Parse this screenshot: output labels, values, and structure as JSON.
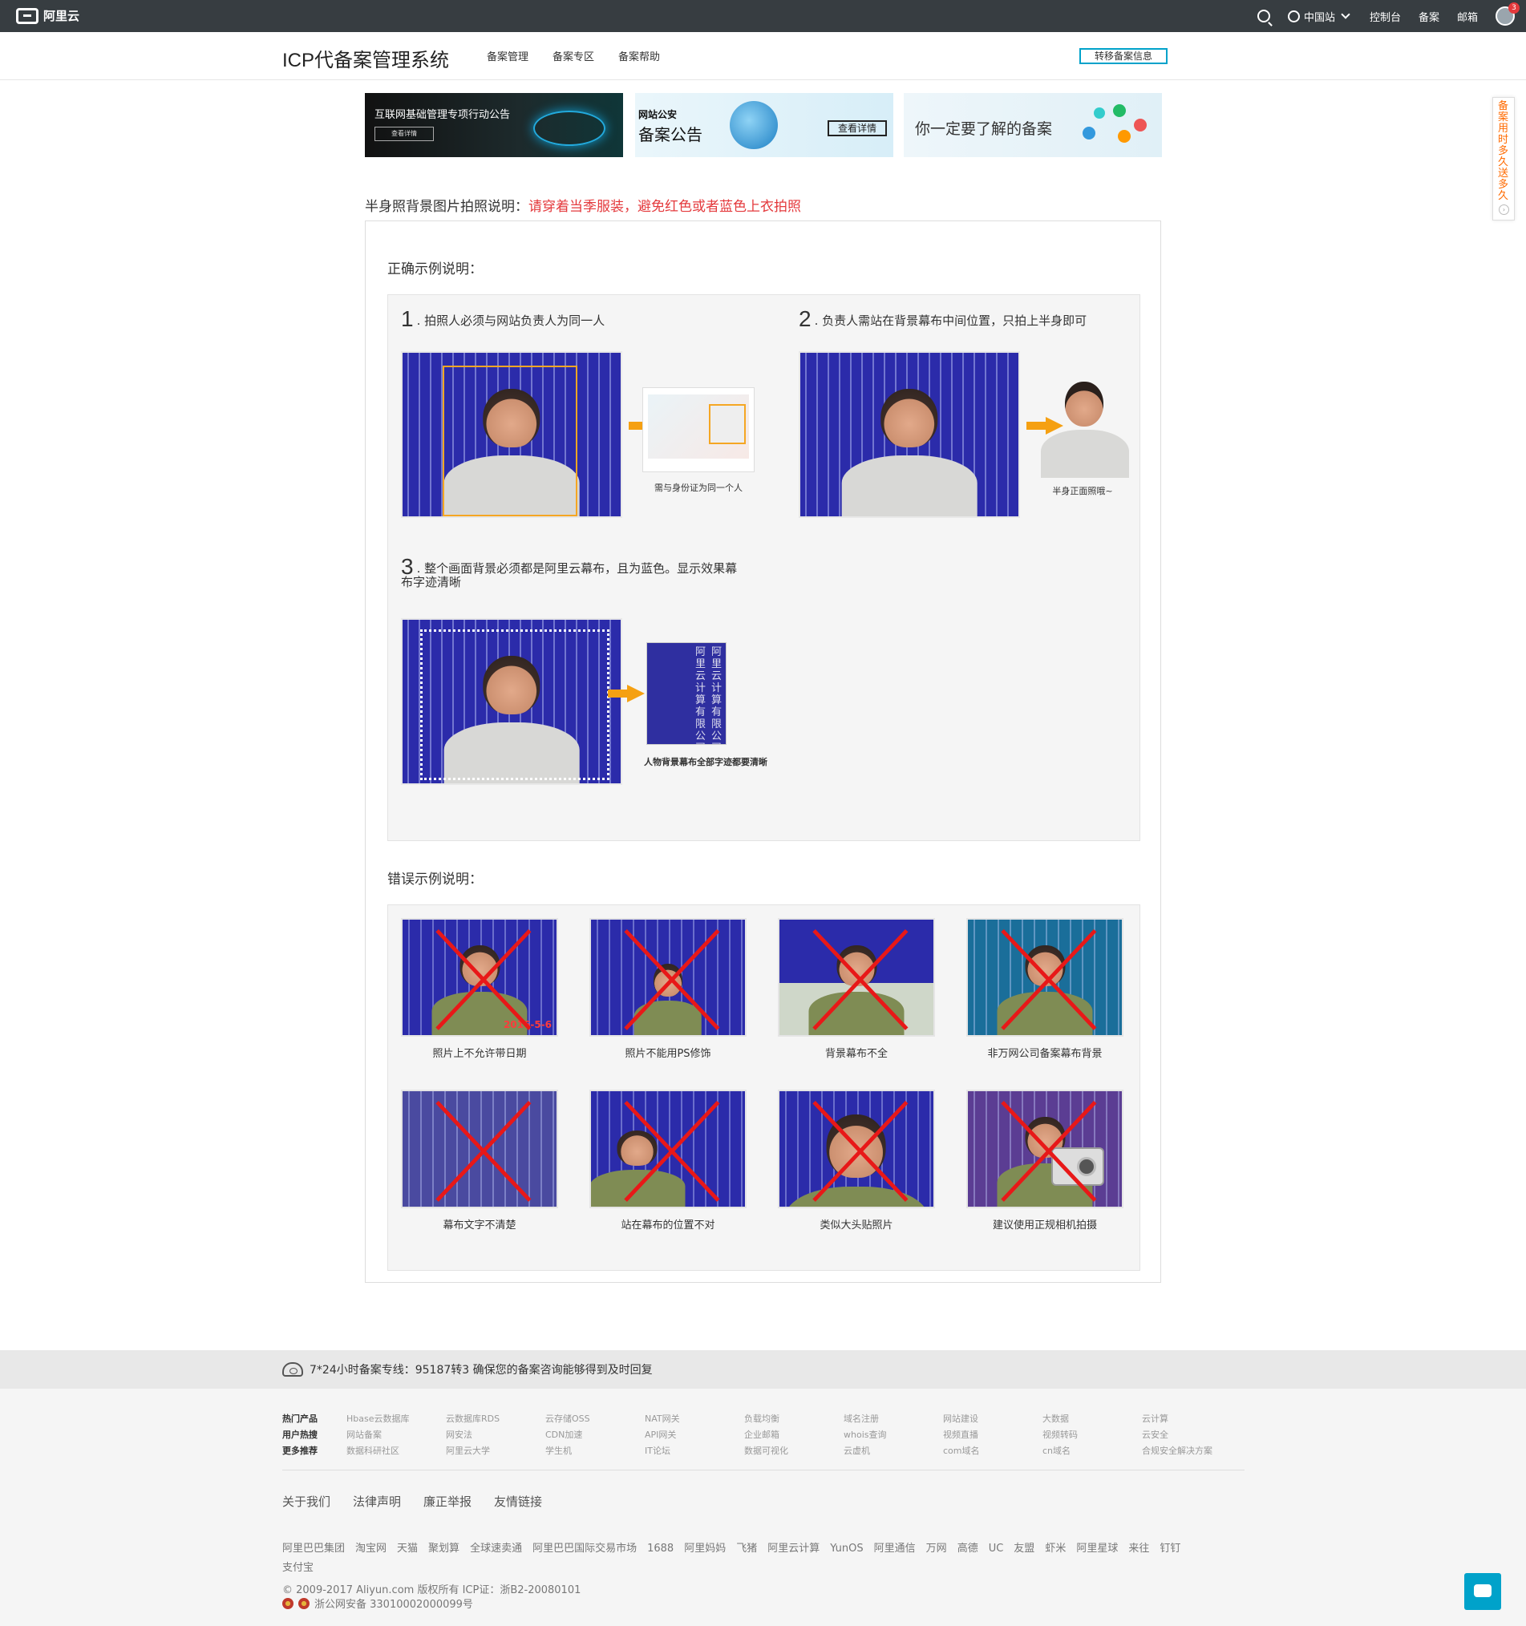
{
  "topbar": {
    "logo": "阿里云",
    "region": "中国站",
    "console": "控制台",
    "beian": "备案",
    "mail": "邮箱",
    "badge_count": "3"
  },
  "header": {
    "title": "ICP代备案管理系统",
    "nav": [
      "备案管理",
      "备案专区",
      "备案帮助"
    ],
    "transfer_button": "转移备案信息"
  },
  "banners": {
    "b1_title": "互联网基础管理专项行动公告",
    "b1_button": "查看详情",
    "b2_small": "网站公安",
    "b2_big": "备案公告",
    "b2_button": "查看详情",
    "b3_title": "你一定要了解的备案"
  },
  "side_tab": "备案用时多久送多久",
  "notice": {
    "label": "半身照背景图片拍照说明：",
    "warning": "请穿着当季服装，避免红色或者蓝色上衣拍照"
  },
  "correct": {
    "title": "正确示例说明：",
    "ex1": {
      "num": "1",
      "text": ". 拍照人必须与网站负责人为同一人",
      "caption": "需与身份证为同一个人"
    },
    "ex2": {
      "num": "2",
      "text": ". 负责人需站在背景幕布中间位置，只拍上半身即可",
      "caption": "半身正面照哦~"
    },
    "ex3": {
      "num": "3",
      "text": ". 整个画面背景必须都是阿里云幕布，且为蓝色。显示效果幕布字迹清晰",
      "caption": "人物背景幕布全部字迹都要清晰"
    },
    "bg_text": [
      "阿里云计算有限公司",
      "阿里云计算有限公司"
    ]
  },
  "wrong": {
    "title": "错误示例说明：",
    "items": [
      {
        "caption": "照片上不允许带日期",
        "stamp": "2016-5-6"
      },
      {
        "caption": "照片不能用PS修饰"
      },
      {
        "caption": "背景幕布不全"
      },
      {
        "caption": "非万网公司备案幕布背景"
      },
      {
        "caption": "幕布文字不清楚"
      },
      {
        "caption": "站在幕布的位置不对"
      },
      {
        "caption": "类似大头贴照片"
      },
      {
        "caption": "建议使用正规相机拍摄"
      }
    ]
  },
  "footer": {
    "hotline": "7*24小时备案专线：95187转3 确保您的备案咨询能够得到及时回复",
    "rows": [
      {
        "label": "热门产品",
        "items": [
          "Hbase云数据库",
          "云数据库RDS",
          "云存储OSS",
          "NAT网关",
          "负载均衡",
          "域名注册",
          "网站建设",
          "大数据",
          "云计算"
        ]
      },
      {
        "label": "用户热搜",
        "items": [
          "网站备案",
          "网安法",
          "CDN加速",
          "API网关",
          "企业邮箱",
          "whois查询",
          "视频直播",
          "视频转码",
          "云安全"
        ]
      },
      {
        "label": "更多推荐",
        "items": [
          "数据科研社区",
          "阿里云大学",
          "学生机",
          "IT论坛",
          "数据可视化",
          "云虚机",
          "com域名",
          "cn域名",
          "合规安全解决方案"
        ]
      }
    ],
    "links": [
      "关于我们",
      "法律声明",
      "廉正举报",
      "友情链接"
    ],
    "partners": [
      "阿里巴巴集团",
      "淘宝网",
      "天猫",
      "聚划算",
      "全球速卖通",
      "阿里巴巴国际交易市场",
      "1688",
      "阿里妈妈",
      "飞猪",
      "阿里云计算",
      "YunOS",
      "阿里通信",
      "万网",
      "高德",
      "UC",
      "友盟",
      "虾米",
      "阿里星球",
      "来往",
      "钉钉",
      "支付宝"
    ],
    "copyright": "© 2009-2017 Aliyun.com 版权所有 ICP证：浙B2-20080101",
    "police": "浙公网安备 33010002000099号"
  }
}
